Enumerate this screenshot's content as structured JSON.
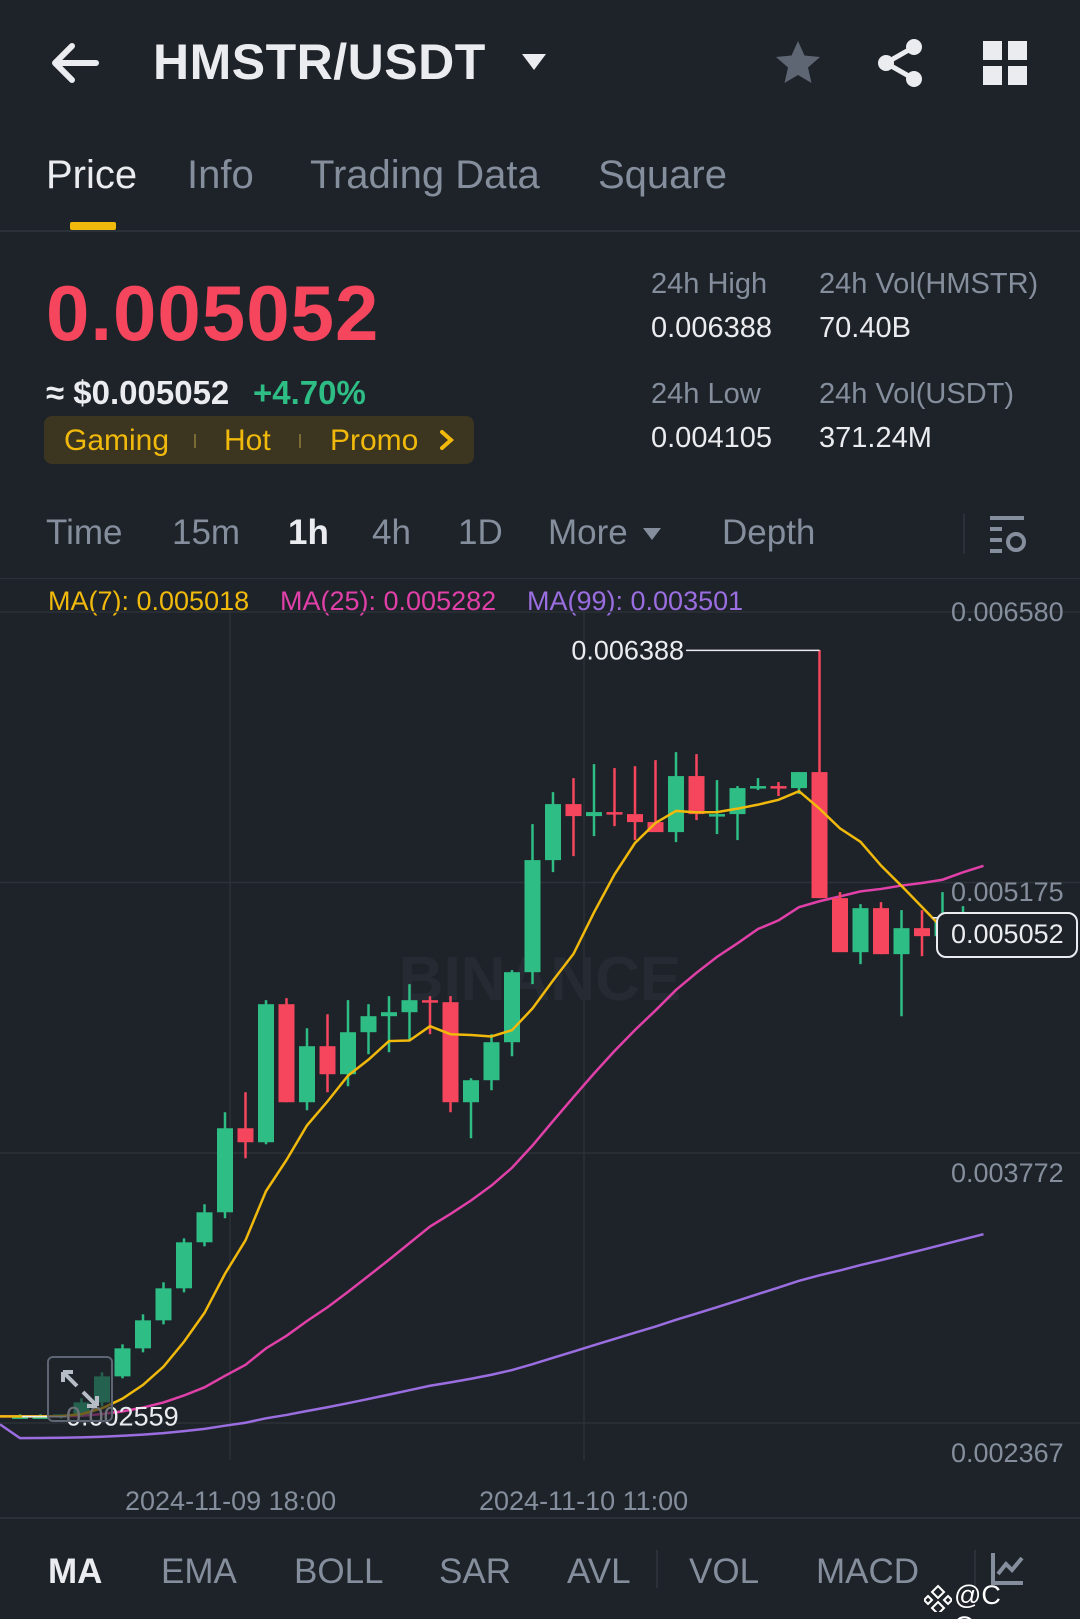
{
  "header": {
    "pair": "HMSTR/USDT",
    "icons": [
      "back-arrow-icon",
      "caret-down-icon",
      "star-icon",
      "share-icon",
      "grid-icon"
    ]
  },
  "tabs": [
    "Price",
    "Info",
    "Trading Data",
    "Square"
  ],
  "price": {
    "last": "0.005052",
    "usd": "≈ $0.005052",
    "change": "+4.70%",
    "tags": [
      "Gaming",
      "Hot",
      "Promo"
    ]
  },
  "stats": {
    "high_label": "24h High",
    "high_value": "0.006388",
    "low_label": "24h Low",
    "low_value": "0.004105",
    "vol_base_label": "24h Vol(HMSTR)",
    "vol_base_value": "70.40B",
    "vol_quote_label": "24h Vol(USDT)",
    "vol_quote_value": "371.24M"
  },
  "intervals": [
    "Time",
    "15m",
    "1h",
    "4h",
    "1D",
    "More",
    "Depth"
  ],
  "ma_legend": {
    "ma7": "MA(7): 0.005018",
    "ma25": "MA(25): 0.005282",
    "ma99": "MA(99): 0.003501"
  },
  "indicators": [
    "MA",
    "EMA",
    "BOLL",
    "SAR",
    "AVL",
    "VOL",
    "MACD"
  ],
  "watermark": "@C Queen",
  "colors": {
    "bg": "#1e2329",
    "up": "#2ebd85",
    "down": "#f6465d",
    "accent": "#f0b90b",
    "ma7": "#f0b90b",
    "ma25": "#e040a8",
    "ma99": "#9a6ee0",
    "muted": "#848e9c"
  },
  "chart_data": {
    "type": "candlestick",
    "y_ticks": [
      "0.006580",
      "0.005175",
      "0.003772",
      "0.002367"
    ],
    "x_ticks": [
      "2024-11-09 18:00",
      "2024-11-10 11:00"
    ],
    "high_marker": "0.006388",
    "low_marker": "0.002559",
    "last_price_tag": "0.005052",
    "ylim": [
      0.002367,
      0.00658
    ],
    "candles": [
      [
        0.00256,
        0.00257,
        0.00255,
        0.00256
      ],
      [
        0.00256,
        0.00257,
        0.00255,
        0.00256
      ],
      [
        0.00256,
        0.00257,
        0.00255,
        0.00257
      ],
      [
        0.00257,
        0.00265,
        0.00256,
        0.00263
      ],
      [
        0.00263,
        0.00278,
        0.00261,
        0.00276
      ],
      [
        0.00276,
        0.00292,
        0.00275,
        0.0029
      ],
      [
        0.0029,
        0.00307,
        0.00288,
        0.00304
      ],
      [
        0.00304,
        0.00323,
        0.00302,
        0.0032
      ],
      [
        0.0032,
        0.00345,
        0.00318,
        0.00343
      ],
      [
        0.00343,
        0.00362,
        0.00341,
        0.00358
      ],
      [
        0.00358,
        0.00408,
        0.00355,
        0.004
      ],
      [
        0.004,
        0.00418,
        0.00385,
        0.00393
      ],
      [
        0.00393,
        0.00464,
        0.00392,
        0.00462
      ],
      [
        0.00462,
        0.00465,
        0.00413,
        0.00413
      ],
      [
        0.00413,
        0.0045,
        0.00409,
        0.00441
      ],
      [
        0.00441,
        0.00457,
        0.00418,
        0.00427
      ],
      [
        0.00427,
        0.00464,
        0.00421,
        0.00448
      ],
      [
        0.00448,
        0.00462,
        0.00437,
        0.00456
      ],
      [
        0.00456,
        0.00466,
        0.00438,
        0.00458
      ],
      [
        0.00458,
        0.00472,
        0.00444,
        0.00464
      ],
      [
        0.00464,
        0.00466,
        0.00447,
        0.00463
      ],
      [
        0.00463,
        0.00466,
        0.00408,
        0.00413
      ],
      [
        0.00413,
        0.00425,
        0.00395,
        0.00424
      ],
      [
        0.00424,
        0.00447,
        0.00419,
        0.00443
      ],
      [
        0.00443,
        0.00479,
        0.00436,
        0.00478
      ],
      [
        0.00478,
        0.00552,
        0.00472,
        0.00534
      ],
      [
        0.00534,
        0.00568,
        0.00528,
        0.00562
      ],
      [
        0.00562,
        0.00575,
        0.00536,
        0.00556
      ],
      [
        0.00556,
        0.00582,
        0.00546,
        0.00558
      ],
      [
        0.00558,
        0.0058,
        0.00551,
        0.00557
      ],
      [
        0.00557,
        0.00581,
        0.00544,
        0.00553
      ],
      [
        0.00553,
        0.00584,
        0.0055,
        0.00548
      ],
      [
        0.00548,
        0.00588,
        0.00543,
        0.00576
      ],
      [
        0.00576,
        0.00587,
        0.00554,
        0.00557
      ],
      [
        0.00557,
        0.00574,
        0.00547,
        0.00557
      ],
      [
        0.00557,
        0.00571,
        0.00544,
        0.0057
      ],
      [
        0.0057,
        0.00575,
        0.00569,
        0.00571
      ],
      [
        0.00571,
        0.00573,
        0.00566,
        0.0057
      ],
      [
        0.0057,
        0.00578,
        0.00567,
        0.00578
      ],
      [
        0.00578,
        0.00639,
        0.00515,
        0.00515
      ],
      [
        0.00515,
        0.00518,
        0.00488,
        0.00488
      ],
      [
        0.00488,
        0.00512,
        0.00482,
        0.0051
      ],
      [
        0.0051,
        0.00513,
        0.00487,
        0.00487
      ],
      [
        0.00487,
        0.00509,
        0.00456,
        0.005
      ],
      [
        0.005,
        0.00509,
        0.00486,
        0.00496
      ],
      [
        0.00496,
        0.00518,
        0.00495,
        0.00504
      ],
      [
        0.00504,
        0.00511,
        0.005,
        0.00505
      ],
      [
        0.00505,
        0.00507,
        0.00503,
        0.005052
      ]
    ]
  }
}
